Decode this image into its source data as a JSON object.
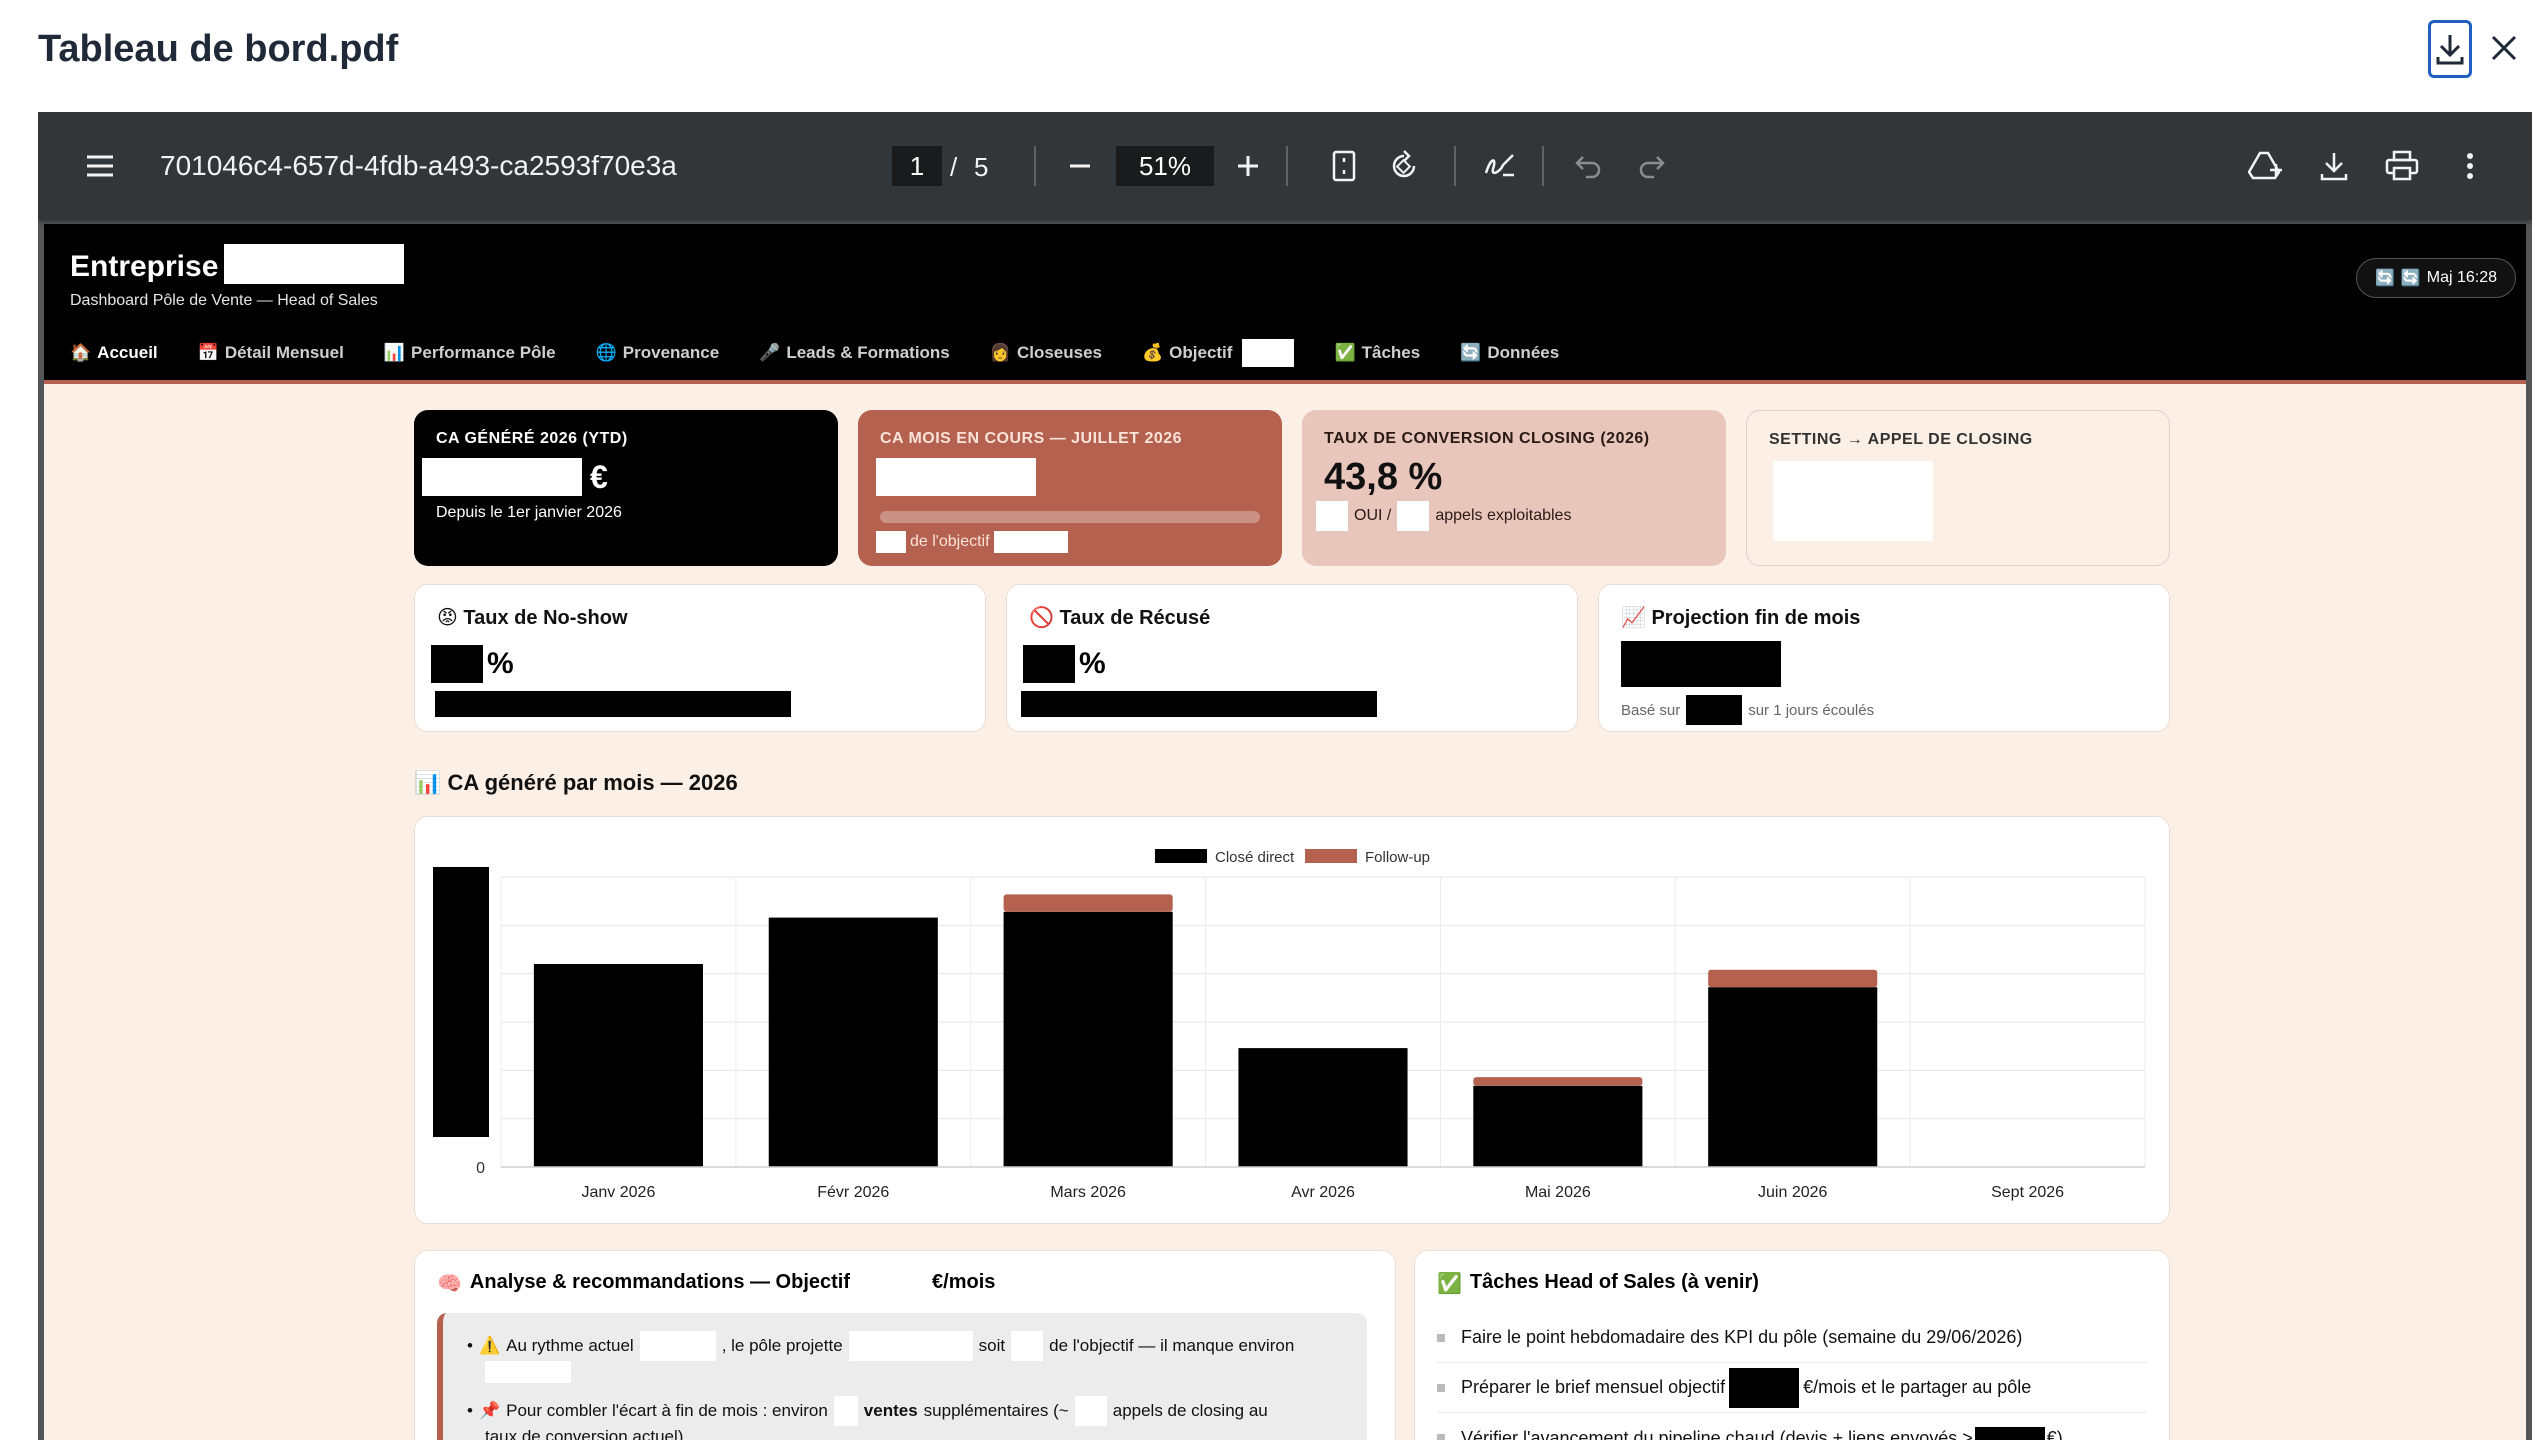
{
  "modal": {
    "title": "Tableau de bord.pdf"
  },
  "toolbar": {
    "doc_title": "701046c4-657d-4fdb-a493-ca2593f70e3a",
    "page_current": "1",
    "page_sep": "/",
    "page_total": "5",
    "zoom": "51%"
  },
  "dashboard": {
    "brand": "Entreprise",
    "subtitle": "Dashboard Pôle de Vente — Head of Sales",
    "maj": "Maj 16:28",
    "nav": [
      {
        "icon": "🏠",
        "label": "Accueil"
      },
      {
        "icon": "📅",
        "label": "Détail Mensuel"
      },
      {
        "icon": "📊",
        "label": "Performance Pôle"
      },
      {
        "icon": "🌐",
        "label": "Provenance"
      },
      {
        "icon": "🎤",
        "label": "Leads & Formations"
      },
      {
        "icon": "👩",
        "label": "Closeuses"
      },
      {
        "icon": "💰",
        "label": "Objectif"
      },
      {
        "icon": "✅",
        "label": "Tâches"
      },
      {
        "icon": "🔄",
        "label": "Données"
      }
    ],
    "kpis": {
      "ytd": {
        "label": "CA GÉNÉRÉ 2026 (YTD)",
        "currency": "€",
        "sub": "Depuis le 1er janvier 2026"
      },
      "month": {
        "label": "CA MOIS EN COURS — JUILLET 2026",
        "sub": "de l'objectif"
      },
      "conversion": {
        "label": "TAUX DE CONVERSION CLOSING (2026)",
        "value": "43,8 %",
        "sub_a": "OUI /",
        "sub_b": "appels exploitables"
      },
      "setting": {
        "label": "SETTING → APPEL DE CLOSING"
      }
    },
    "cards": {
      "noshow": {
        "icon": "😡",
        "title": "Taux de No-show",
        "unit": "%"
      },
      "refuse": {
        "icon": "🚫",
        "title": "Taux de Récusé",
        "unit": "%"
      },
      "projection": {
        "icon": "📈",
        "title": "Projection fin de mois",
        "sub_a": "Basé sur",
        "sub_b": "sur 1 jours écoulés"
      }
    },
    "chart_title": {
      "icon": "📊",
      "text": "CA généré par mois — 2026"
    },
    "analysis": {
      "icon": "🧠",
      "title": "Analyse & recommandations — Objectif",
      "title_suffix": "€/mois",
      "bullet1_icon": "⚠️",
      "bullet1_a": "Au rythme actuel",
      "bullet1_b": ", le pôle projette",
      "bullet1_c": "soit",
      "bullet1_d": "de l'objectif — il manque environ",
      "bullet2_icon": "📌",
      "bullet2_a": "Pour combler l'écart à fin de mois : environ",
      "bullet2_b": "ventes",
      "bullet2_c": "supplémentaires (~",
      "bullet2_d": "appels de closing au",
      "bullet2_e": "taux de conversion actuel)"
    },
    "tasks": {
      "icon": "✅",
      "title": "Tâches Head of Sales (à venir)",
      "items": [
        "Faire le point hebdomadaire des KPI du pôle (semaine du 29/06/2026)",
        "Préparer le brief mensuel objectif",
        "€/mois et le partager au pôle",
        "Vérifier l'avancement du pipeline chaud (devis + liens envoyés >",
        "€)"
      ]
    }
  },
  "chart_data": {
    "type": "bar",
    "categories": [
      "Janv 2026",
      "Févr 2026",
      "Mars 2026",
      "Avr 2026",
      "Mai 2026",
      "Juin 2026",
      "Sept 2026"
    ],
    "series": [
      {
        "name": "Closé direct",
        "color": "#000000",
        "values": [
          70,
          86,
          88,
          41,
          28,
          62,
          0
        ]
      },
      {
        "name": "Follow-up",
        "color": "#b5614f",
        "values": [
          0,
          0,
          6,
          0,
          3,
          6,
          0
        ]
      }
    ],
    "y_tick_label": "0",
    "ylim": [
      0,
      100
    ],
    "legend": "top-center",
    "grid": true
  },
  "colors": {
    "accent": "#b5614f",
    "page_bg": "#fbefe6",
    "kpi_month_bg": "#b5614f",
    "kpi_conversion_bg": "#e9c6bb"
  }
}
